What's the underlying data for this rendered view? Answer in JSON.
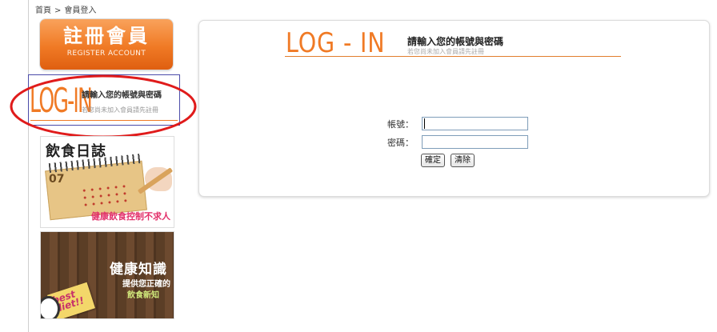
{
  "breadcrumb": {
    "home": "首頁",
    "separator": ">",
    "current": "會員登入"
  },
  "sidebar": {
    "register": {
      "title": "註冊會員",
      "subtitle": "REGISTER ACCOUNT"
    },
    "login_banner": {
      "logo": "LOG-IN",
      "line1": "請輸入您的帳號與密碼",
      "line2": "若您尚未加入會員請先註冊"
    },
    "diet_diary": {
      "title": "飲食日誌",
      "calendar_number": "07",
      "caption": "健康飲食控制不求人"
    },
    "health_knowledge": {
      "title": "健康知識",
      "line1": "提供您正確的",
      "line2": "飲食新知",
      "note": "best diet!!"
    }
  },
  "login_panel": {
    "logo": "LOG - IN",
    "heading": "請輸入您的帳號與密碼",
    "subheading": "若您尚未加入會員請先註冊",
    "account_label": "帳號：",
    "account_value": "",
    "password_label": "密碼：",
    "password_value": "",
    "confirm_button": "確定",
    "clear_button": "清除"
  },
  "colors": {
    "accent": "#f07a25",
    "highlight_circle": "#e01b1b",
    "input_border": "#7f9db9"
  }
}
